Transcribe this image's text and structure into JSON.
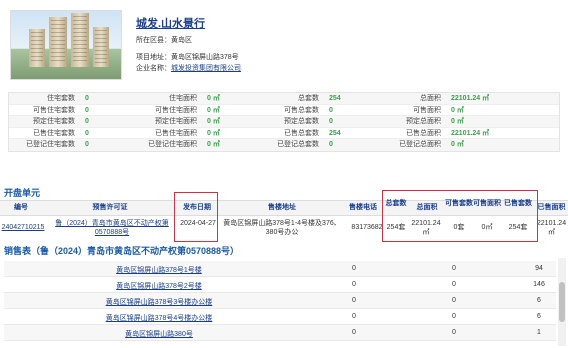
{
  "project": {
    "title": "城发.山水景行",
    "district_label": "所在区县：",
    "district": "黄岛区",
    "address_label": "项目地址：",
    "address": "黄岛区锦屏山路378号",
    "company_label": "企业名称：",
    "company": "城发投资集团有限公司"
  },
  "stats": [
    [
      "住宅套数",
      "0",
      "住宅面积",
      "0 ㎡",
      "总套数",
      "254",
      "总面积",
      "22101.24 ㎡"
    ],
    [
      "可售住宅套数",
      "0",
      "可售住宅面积",
      "0 ㎡",
      "可售总套数",
      "0",
      "可售面积",
      "0 ㎡"
    ],
    [
      "预定住宅套数",
      "0",
      "预定住宅面积",
      "0 ㎡",
      "预定总套数",
      "0",
      "预定总面积",
      "0 ㎡"
    ],
    [
      "已售住宅套数",
      "0",
      "已售住宅面积",
      "0 ㎡",
      "已售总套数",
      "254",
      "已售总面积",
      "22101.24 ㎡"
    ],
    [
      "已登记住宅套数",
      "0",
      "已登记住宅面积",
      "0 ㎡",
      "已登记总套数",
      "0",
      "已登记总面积",
      "0 ㎡"
    ]
  ],
  "units_section": {
    "heading": "开盘单元",
    "headers": {
      "id": "编号",
      "permit": "预售许可证",
      "date": "发布日期",
      "address": "售楼地址",
      "phone": "售楼电话",
      "total_units": "总套数",
      "total_area": "总面积",
      "avail_units": "可售套数",
      "avail_area": "可售面积",
      "sold_units": "已售套数",
      "sold_area": "已售面积"
    },
    "row": {
      "id": "24042710215",
      "permit": "鲁（2024）青岛市黄岛区不动产权第0570888号",
      "date": "2024-04-27",
      "address": "黄岛区锦屏山路378号1-4号楼及376、380号办公",
      "phone": "83173682",
      "total_units": "254套",
      "total_area": "22101.24㎡",
      "avail_units": "0套",
      "avail_area": "0㎡",
      "sold_units": "254套",
      "sold_area": "22101.24㎡"
    }
  },
  "sales_section": {
    "heading": "销售表（鲁（2024）青岛市黄岛区不动产权第0570888号）",
    "rows": [
      {
        "name": "黄岛区锦屏山路378号1号楼",
        "a": "0",
        "b": "0",
        "c": "94"
      },
      {
        "name": "黄岛区锦屏山路378号2号楼",
        "a": "0",
        "b": "0",
        "c": "146"
      },
      {
        "name": "黄岛区锦屏山路378号3号楼办公楼",
        "a": "0",
        "b": "0",
        "c": "6"
      },
      {
        "name": "黄岛区锦屏山路378号4号楼办公楼",
        "a": "0",
        "b": "0",
        "c": "6"
      },
      {
        "name": "黄岛区锦屏山路380号",
        "a": "0",
        "b": "0",
        "c": "1"
      }
    ]
  },
  "colors": {
    "link": "#1a3e8c",
    "highlight_box": "#d8303c",
    "stat_value": "#3aa24a"
  }
}
